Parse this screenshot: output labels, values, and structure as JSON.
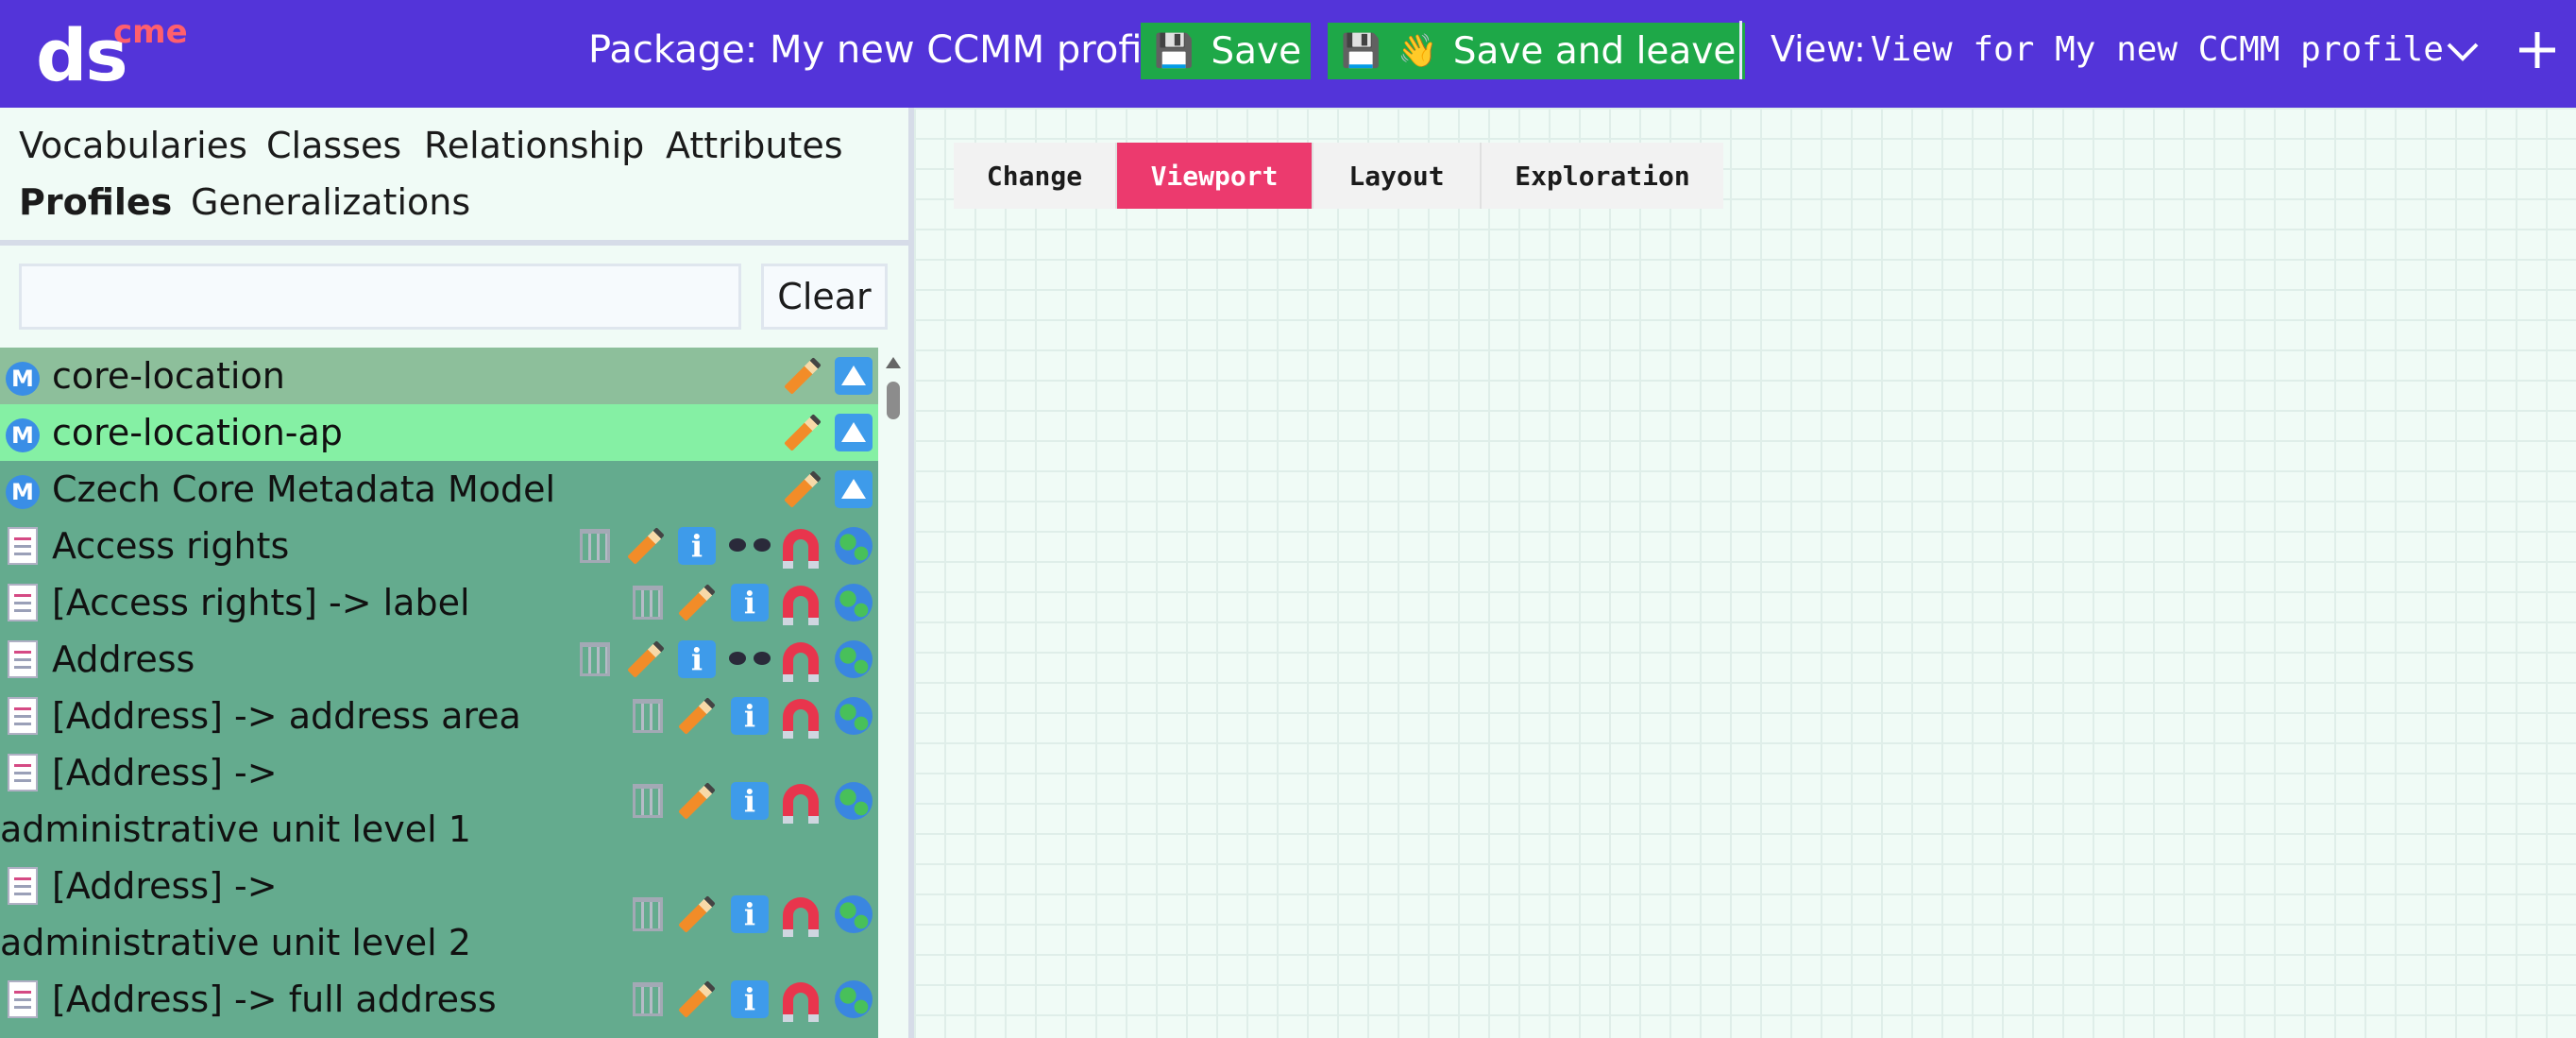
{
  "header": {
    "logo_main": "ds",
    "logo_sup": "cme",
    "package_text": "Package: My new CCMM profile",
    "save_label": "Save",
    "save_leave_label": "Save and leave",
    "view_label": "View:",
    "view_name": "View for My new CCMM profile",
    "floppy_icon": "💾",
    "wave_icon": "👋"
  },
  "sidebar": {
    "tabs": [
      "Vocabularies",
      "Classes",
      "Relationship",
      "Attributes",
      "Profiles",
      "Generalizations"
    ],
    "active_tab": "Profiles",
    "search_value": "",
    "clear_label": "Clear",
    "items": [
      {
        "label": "core-location",
        "kind": "vocabulary"
      },
      {
        "label": "core-location-ap",
        "kind": "vocabulary"
      },
      {
        "label": "Czech Core Metadata Model",
        "kind": "vocabulary"
      },
      {
        "label": "Access rights",
        "kind": "class"
      },
      {
        "label": "[Access rights] -> label",
        "kind": "attribute"
      },
      {
        "label": "Address",
        "kind": "class"
      },
      {
        "label": "[Address] -> address area",
        "kind": "attribute"
      },
      {
        "label": "[Address] -> administrative unit level 1",
        "kind": "attribute"
      },
      {
        "label": "[Address] -> administrative unit level 2",
        "kind": "attribute"
      },
      {
        "label": "[Address] -> full address",
        "kind": "attribute"
      }
    ],
    "vocab_badge": "M"
  },
  "canvas": {
    "tabs": [
      "Change",
      "Viewport",
      "Layout",
      "Exploration"
    ],
    "active_tab": "Viewport"
  },
  "colors": {
    "header_bg": "#5334d9",
    "save_btn": "#1ea848",
    "active_canvas_tab": "#ec3a6e",
    "row_bg": "#64ab8e",
    "row_highlight": "#85f0a4"
  }
}
